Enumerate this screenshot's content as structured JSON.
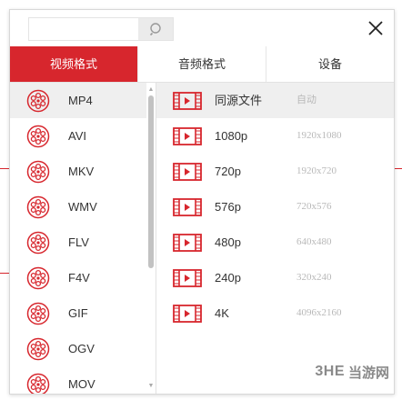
{
  "accent_color": "#d7262d",
  "search": {
    "placeholder": "",
    "value": ""
  },
  "tabs": [
    {
      "label": "视频格式",
      "active": true
    },
    {
      "label": "音频格式",
      "active": false
    },
    {
      "label": "设备",
      "active": false
    }
  ],
  "formats": [
    {
      "label": "MP4",
      "selected": true
    },
    {
      "label": "AVI",
      "selected": false
    },
    {
      "label": "MKV",
      "selected": false
    },
    {
      "label": "WMV",
      "selected": false
    },
    {
      "label": "FLV",
      "selected": false
    },
    {
      "label": "F4V",
      "selected": false
    },
    {
      "label": "GIF",
      "selected": false
    },
    {
      "label": "OGV",
      "selected": false
    },
    {
      "label": "MOV",
      "selected": false
    }
  ],
  "resolutions": [
    {
      "name": "同源文件",
      "size": "自动",
      "selected": true
    },
    {
      "name": "1080p",
      "size": "1920x1080",
      "selected": false
    },
    {
      "name": "720p",
      "size": "1920x720",
      "selected": false
    },
    {
      "name": "576p",
      "size": "720x576",
      "selected": false
    },
    {
      "name": "480p",
      "size": "640x480",
      "selected": false
    },
    {
      "name": "240p",
      "size": "320x240",
      "selected": false
    },
    {
      "name": "4K",
      "size": "4096x2160",
      "selected": false
    }
  ],
  "icons": {
    "search": "search-icon",
    "close": "close-icon",
    "format": "film-reel-icon",
    "resolution": "video-play-icon"
  },
  "watermark": {
    "logo": "3HE",
    "text": "当游网"
  }
}
